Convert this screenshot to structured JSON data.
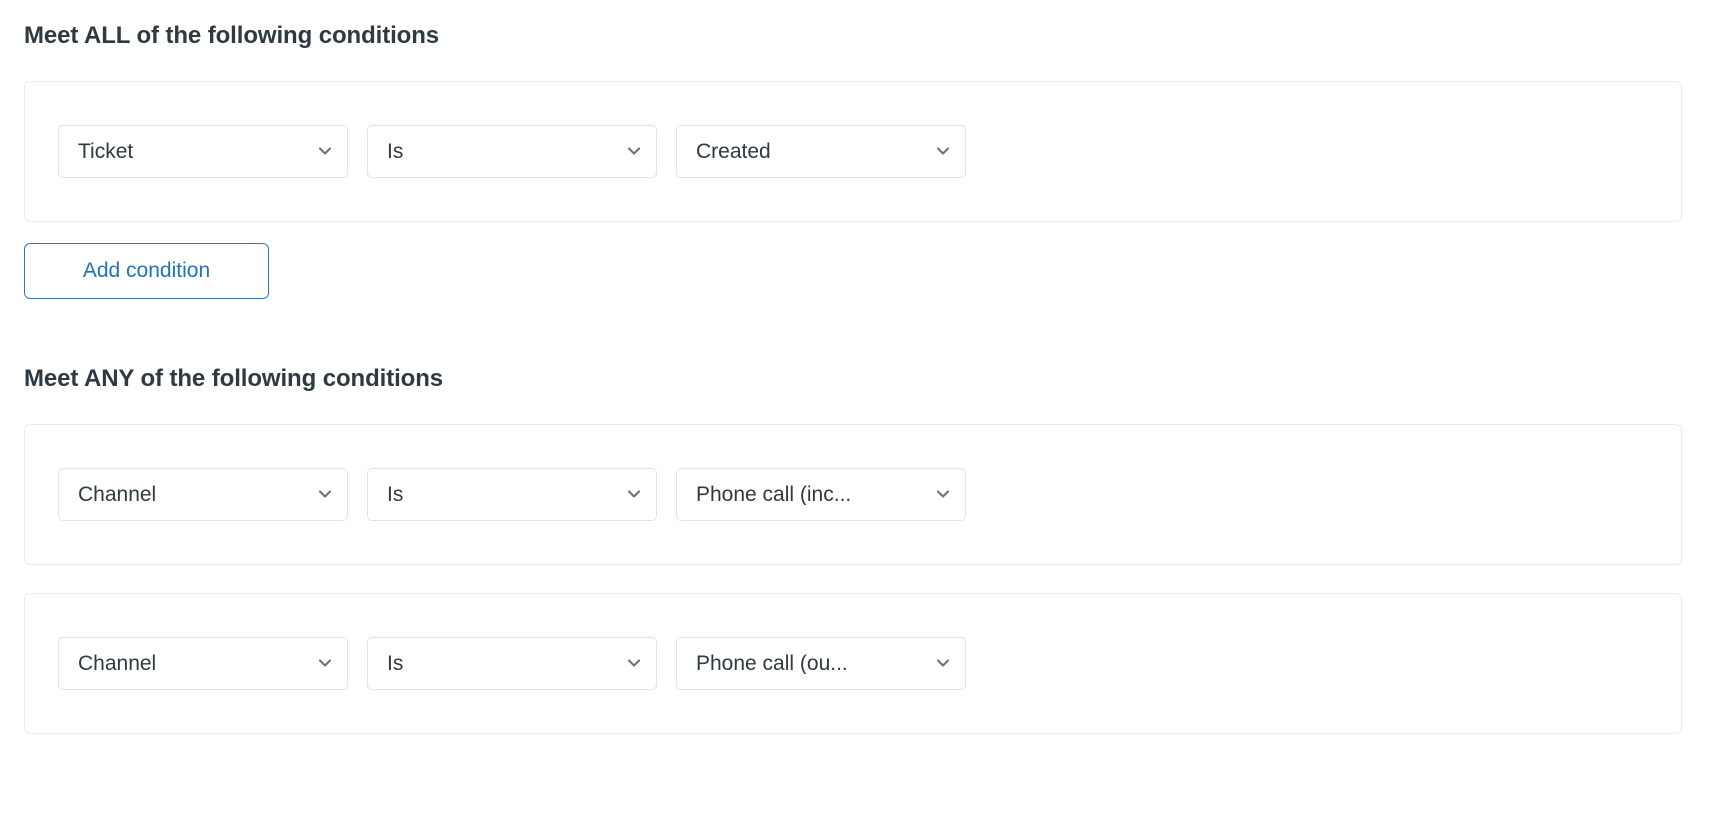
{
  "sections": [
    {
      "heading": "Meet ALL of the following conditions",
      "match_type": "ALL",
      "conditions": [
        {
          "field": "Ticket",
          "operator": "Is",
          "value": "Created"
        }
      ],
      "add_button_label": "Add condition"
    },
    {
      "heading": "Meet ANY of the following conditions",
      "match_type": "ANY",
      "conditions": [
        {
          "field": "Channel",
          "operator": "Is",
          "value": "Phone call (inc..."
        },
        {
          "field": "Channel",
          "operator": "Is",
          "value": "Phone call (ou..."
        }
      ]
    }
  ],
  "icons": {
    "chevron_down": "chevron-down-icon"
  },
  "colors": {
    "text_primary": "#2f3941",
    "link_blue": "#1f73b7",
    "border_blue": "#337ab7",
    "border_grey": "#e9ebed",
    "select_border": "#e0e2e3",
    "background": "#ffffff",
    "chevron_grey": "#68737d"
  }
}
